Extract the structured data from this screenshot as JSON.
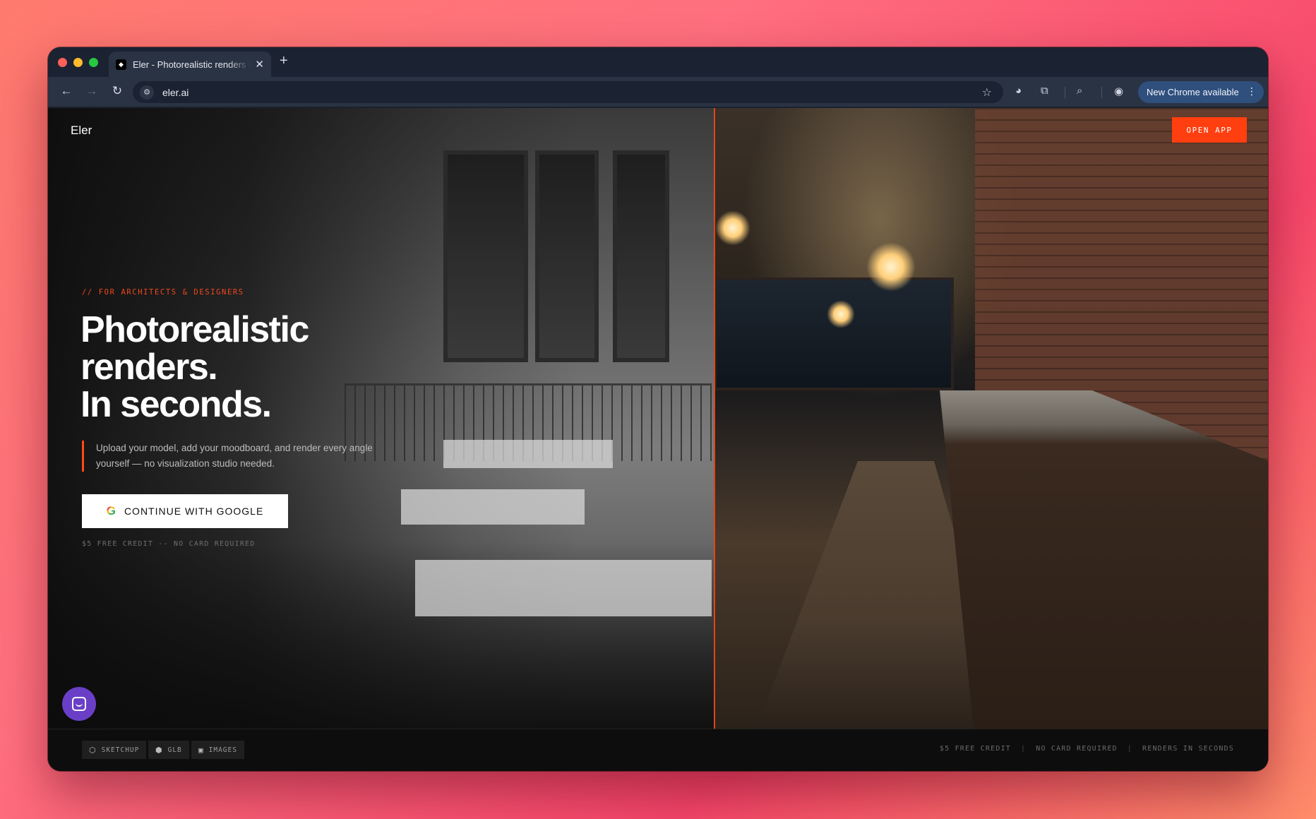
{
  "browser": {
    "tab_title": "Eler - Photorealistic renders in seconds",
    "tab_favicon": "◆",
    "new_tab": "+",
    "url": "eler.ai",
    "update_label": "New Chrome available",
    "icons": [
      "back-icon",
      "forward-icon",
      "reload-icon",
      "site-settings-icon",
      "bookmark-star-icon",
      "gemini-icon",
      "extensions-icon",
      "tab-search-icon",
      "profile-icon",
      "more-vert-icon"
    ]
  },
  "header": {
    "logo": "Eler",
    "open_app": "OPEN APP"
  },
  "hero": {
    "eyebrow": "// FOR ARCHITECTS & DESIGNERS",
    "headline_line1": "Photorealistic",
    "headline_line2": "renders.",
    "headline_line3": "In seconds.",
    "description": "Upload your model, add your moodboard, and render every angle yourself — no visualization studio needed.",
    "cta_label": "CONTINUE WITH GOOGLE",
    "cta_note": "$5 FREE CREDIT -- NO CARD REQUIRED"
  },
  "footer": {
    "chips": [
      {
        "label": "SKETCHUP",
        "icon": "sketchup-icon"
      },
      {
        "label": "GLB",
        "icon": "cube-icon"
      },
      {
        "label": "IMAGES",
        "icon": "image-icon"
      }
    ],
    "right_items": [
      "$5 FREE CREDIT",
      "NO CARD REQUIRED",
      "RENDERS IN SECONDS"
    ],
    "separator": "|"
  },
  "colors": {
    "accent": "#ff3f0f",
    "chat_launcher": "#6a3fc7"
  }
}
